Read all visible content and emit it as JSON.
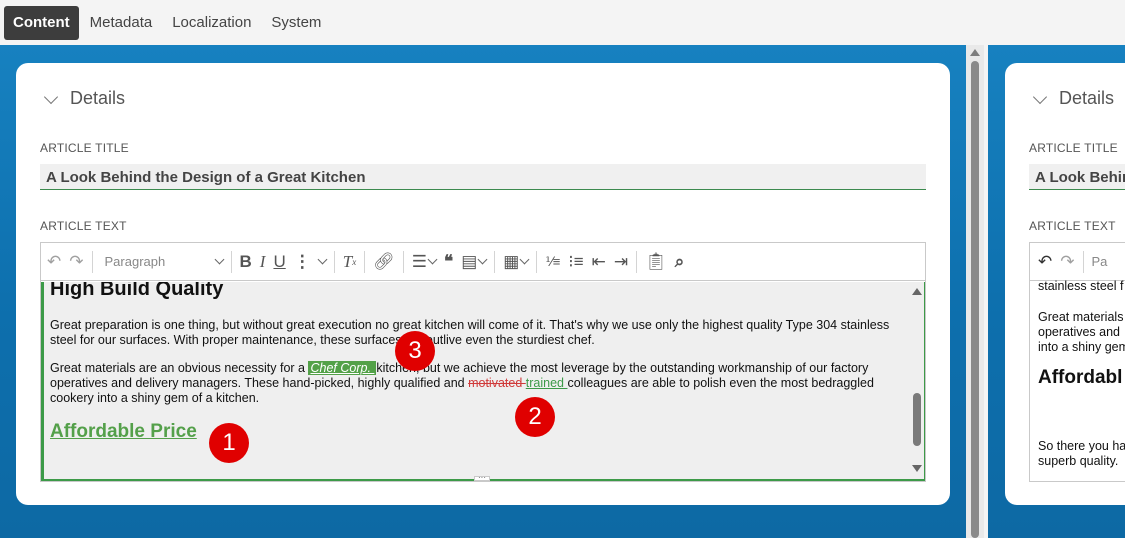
{
  "tabs": [
    {
      "label": "Content",
      "active": true
    },
    {
      "label": "Metadata",
      "active": false
    },
    {
      "label": "Localization",
      "active": false
    },
    {
      "label": "System",
      "active": false
    }
  ],
  "left_panel": {
    "section_title": "Details",
    "article_title_label": "ARTICLE TITLE",
    "article_title_value": "A Look Behind the Design of a Great Kitchen",
    "article_text_label": "ARTICLE TEXT",
    "toolbar": {
      "paragraph_select": "Paragraph",
      "undo_icon": "undo-icon",
      "redo_icon": "redo-icon"
    },
    "content": {
      "heading1": "High Build Quality",
      "p1": "Great preparation is one thing, but without great execution no great kitchen will come of it. That's why we use only the highest quality Type 304 stainless steel for our surfaces. With proper maintenance, these surfaces will outlive even the sturdiest chef.",
      "p2_part1": "Great materials are an obvious necessity for a ",
      "p2_highlight": "Chef Corp. ",
      "p2_part2": " kitchen, but we achieve the most leverage by the outstanding workmanship of our factory operatives and delivery managers. These hand-picked, highly qualified and ",
      "p2_deleted": "motivated ",
      "p2_inserted": "trained ",
      "p2_part3": "colleagues are able to polish even the most bedraggled cookery into a shiny gem of a kitchen.",
      "heading2": "Affordable Price"
    }
  },
  "right_panel": {
    "section_title": "Details",
    "article_title_label": "ARTICLE TITLE",
    "article_title_value": "A Look Behind",
    "article_text_label": "ARTICLE TEXT",
    "toolbar_partial": "Pa",
    "lines": [
      "stainless steel f",
      "Great materials",
      "operatives and",
      "into a shiny gem"
    ],
    "heading": "Affordabl",
    "bottom_lines": [
      "So there you ha",
      "superb quality."
    ]
  },
  "badges": [
    "1",
    "2",
    "3"
  ],
  "colors": {
    "tab_active_bg": "#3d3d3d",
    "workspace_blue": "#1781c0",
    "accent_green": "#3c9a48",
    "badge_red": "#e00000",
    "deleted_red": "#d03a3a"
  }
}
